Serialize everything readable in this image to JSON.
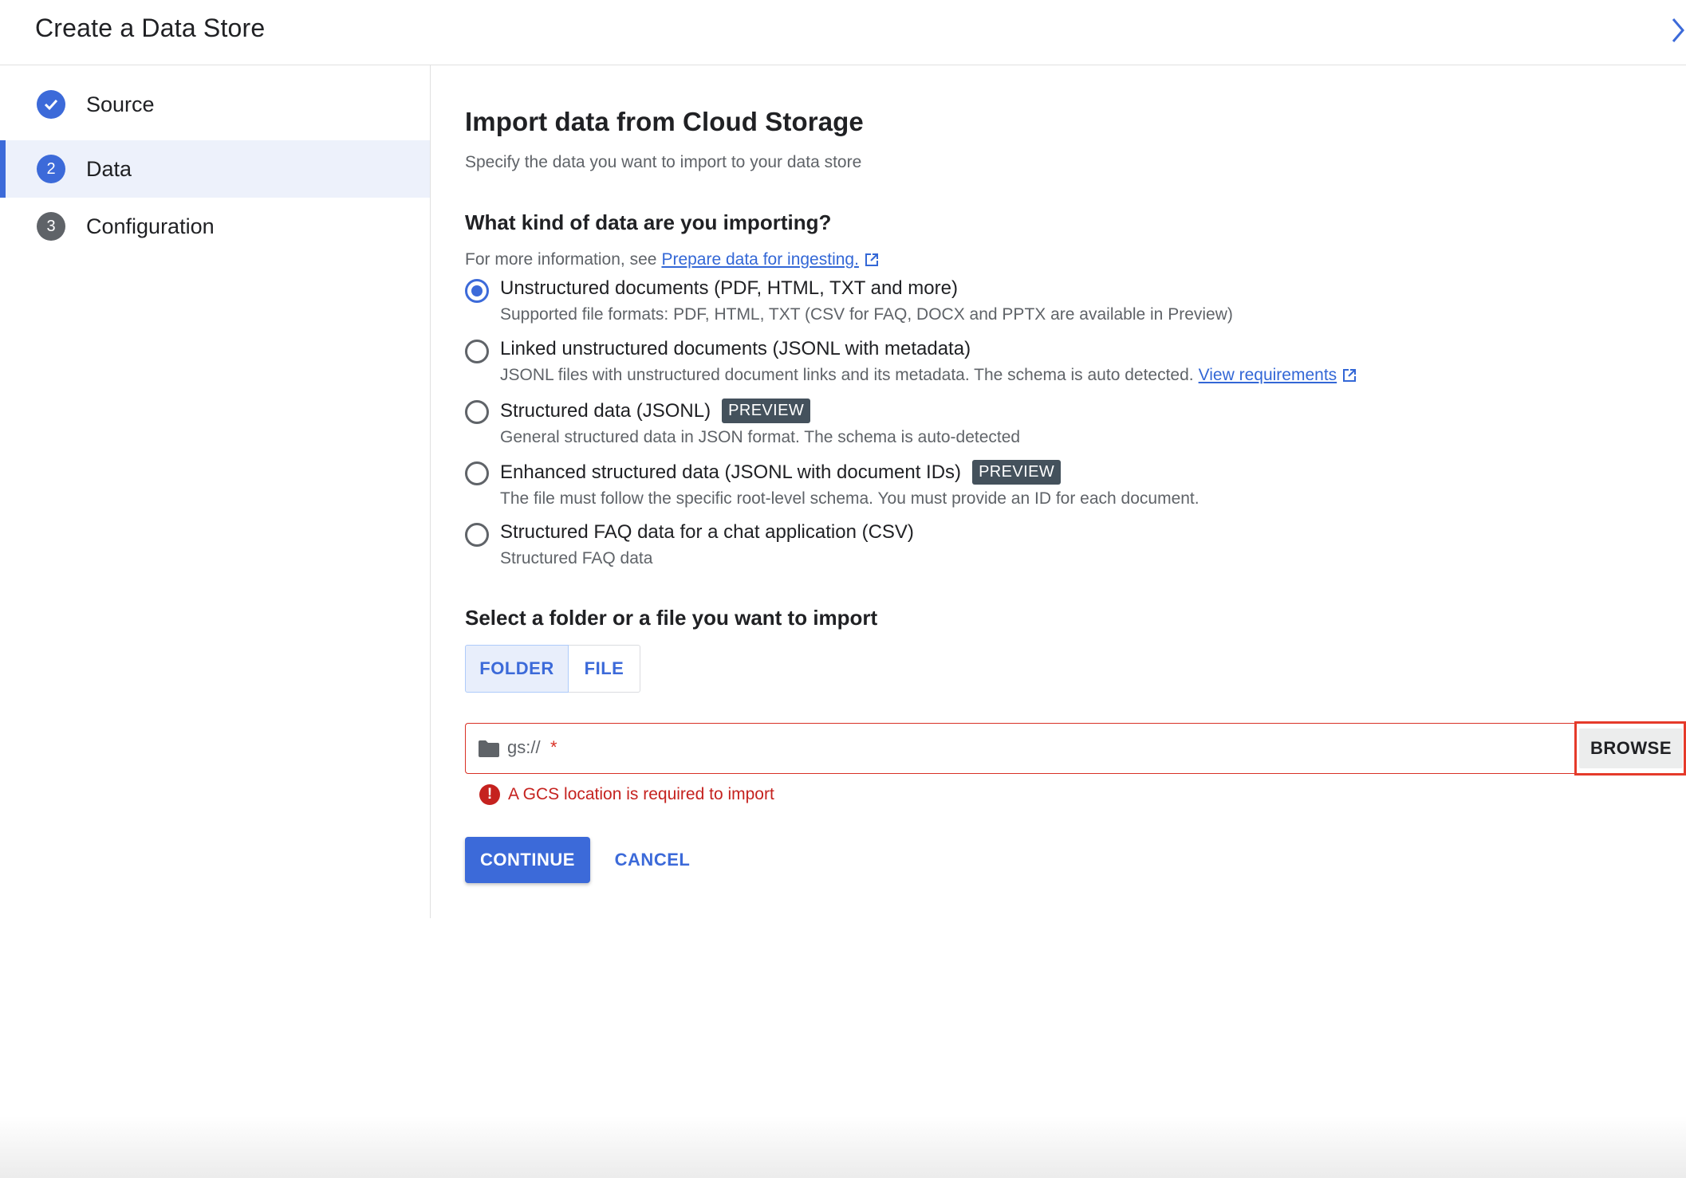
{
  "header": {
    "title": "Create a Data Store",
    "close_icon": "chevron-right-icon"
  },
  "steps": [
    {
      "label": "Source",
      "status": "done",
      "marker": "✓"
    },
    {
      "label": "Data",
      "status": "current",
      "marker": "2"
    },
    {
      "label": "Configuration",
      "status": "todo",
      "marker": "3"
    }
  ],
  "main": {
    "title": "Import data from Cloud Storage",
    "subtitle": "Specify the data you want to import to your data store",
    "question": "What kind of data are you importing?",
    "info_prefix": "For more information, see",
    "info_link": "Prepare data for ingesting.",
    "options": [
      {
        "title": "Unstructured documents (PDF, HTML, TXT and more)",
        "desc": "Supported file formats: PDF, HTML, TXT (CSV for FAQ, DOCX and PPTX are available in Preview)",
        "checked": true
      },
      {
        "title": "Linked unstructured documents (JSONL with metadata)",
        "desc": "JSONL files with unstructured document links and its metadata. The schema is auto detected.",
        "link": "View requirements",
        "checked": false
      },
      {
        "title": "Structured data (JSONL)",
        "badge": "PREVIEW",
        "desc": "General structured data in JSON format. The schema is auto-detected",
        "checked": false
      },
      {
        "title": "Enhanced structured data (JSONL with document IDs)",
        "badge": "PREVIEW",
        "desc": "The file must follow the specific root-level schema. You must provide an ID for each document.",
        "checked": false
      },
      {
        "title": "Structured FAQ data for a chat application (CSV)",
        "desc": "Structured FAQ data",
        "checked": false
      }
    ],
    "select_heading": "Select a folder or a file you want to import",
    "toggle": {
      "folder": "FOLDER",
      "file": "FILE",
      "selected": "FOLDER"
    },
    "gcs": {
      "prefix": "gs://",
      "required_mark": "*",
      "browse": "BROWSE"
    },
    "error": "A GCS location is required to import",
    "continue": "CONTINUE",
    "cancel": "CANCEL"
  },
  "colors": {
    "accent": "#3c6ad9",
    "error": "#c5221f",
    "highlight_box": "#e53a2a",
    "badge_bg": "#44515c"
  }
}
